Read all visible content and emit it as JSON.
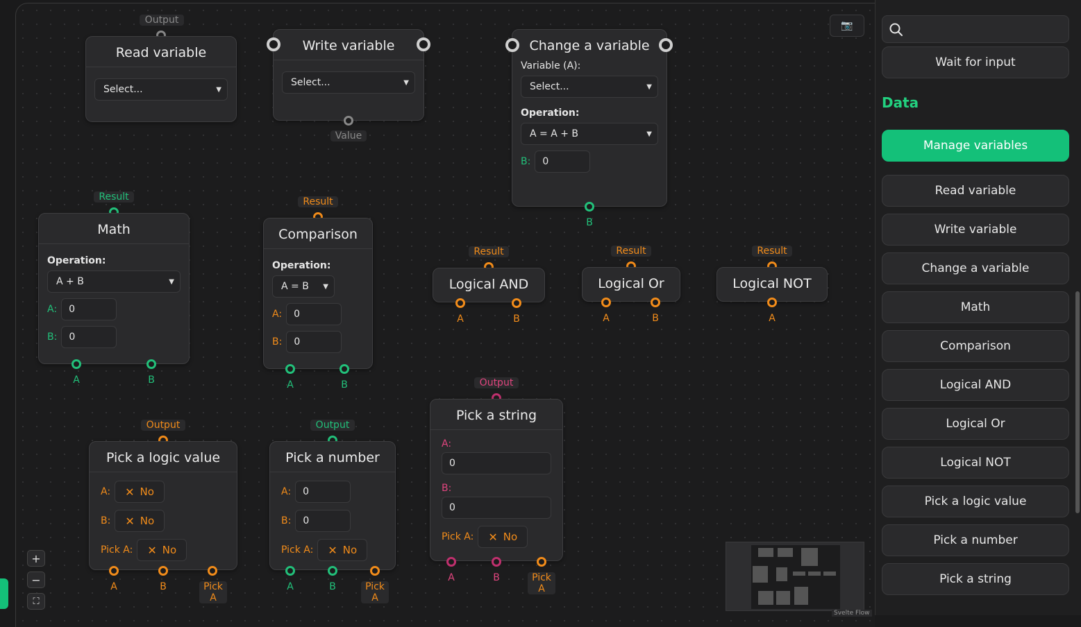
{
  "nodes": {
    "read_variable": {
      "title": "Read variable",
      "select": "Select...",
      "output_label": "Output"
    },
    "write_variable": {
      "title": "Write variable",
      "select": "Select...",
      "value_label": "Value"
    },
    "change_variable": {
      "title": "Change a variable",
      "variable_label": "Variable (A):",
      "select": "Select...",
      "operation_label": "Operation:",
      "operation": "A = A + B",
      "b_label": "B:",
      "b_value": "0",
      "b_handle": "B"
    },
    "math": {
      "title": "Math",
      "result_label": "Result",
      "operation_label": "Operation:",
      "operation": "A + B",
      "a_label": "A:",
      "a_value": "0",
      "b_label": "B:",
      "b_value": "0",
      "h_a": "A",
      "h_b": "B"
    },
    "comparison": {
      "title": "Comparison",
      "result_label": "Result",
      "operation_label": "Operation:",
      "operation": "A = B",
      "a_label": "A:",
      "a_value": "0",
      "b_label": "B:",
      "b_value": "0",
      "h_a": "A",
      "h_b": "B"
    },
    "logical_and": {
      "title": "Logical AND",
      "result_label": "Result",
      "h_a": "A",
      "h_b": "B"
    },
    "logical_or": {
      "title": "Logical Or",
      "result_label": "Result",
      "h_a": "A",
      "h_b": "B"
    },
    "logical_not": {
      "title": "Logical NOT",
      "result_label": "Result",
      "h_a": "A"
    },
    "pick_logic": {
      "title": "Pick a logic value",
      "output_label": "Output",
      "a_label": "A:",
      "a_value": "No",
      "b_label": "B:",
      "b_value": "No",
      "pick_label": "Pick A:",
      "pick_value": "No",
      "h_a": "A",
      "h_b": "B",
      "h_pick_1": "Pick",
      "h_pick_2": "A"
    },
    "pick_number": {
      "title": "Pick a number",
      "output_label": "Output",
      "a_label": "A:",
      "a_value": "0",
      "b_label": "B:",
      "b_value": "0",
      "pick_label": "Pick A:",
      "pick_value": "No",
      "h_a": "A",
      "h_b": "B",
      "h_pick_1": "Pick",
      "h_pick_2": "A"
    },
    "pick_string": {
      "title": "Pick a string",
      "output_label": "Output",
      "a_label": "A:",
      "a_value": "0",
      "b_label": "B:",
      "b_value": "0",
      "pick_label": "Pick A:",
      "pick_value": "No",
      "h_a": "A",
      "h_b": "B",
      "h_pick_1": "Pick",
      "h_pick_2": "A"
    }
  },
  "toggle_icon": "✕",
  "controls": {
    "zoom_in": "+",
    "zoom_out": "−",
    "fit": "⛶"
  },
  "camera_icon": "📷",
  "attribution": "Svelte Flow",
  "sidebar": {
    "search_icon": "search-icon",
    "wait_for_input": "Wait for input",
    "heading": "Data",
    "manage_variables": "Manage variables",
    "items": [
      "Read variable",
      "Write variable",
      "Change a variable",
      "Math",
      "Comparison",
      "Logical AND",
      "Logical Or",
      "Logical NOT",
      "Pick a logic value",
      "Pick a number",
      "Pick a string"
    ]
  },
  "colors": {
    "accent": "#14c079",
    "boolean": "#f28c1a",
    "number": "#22c07a",
    "string": "#c0306e"
  }
}
